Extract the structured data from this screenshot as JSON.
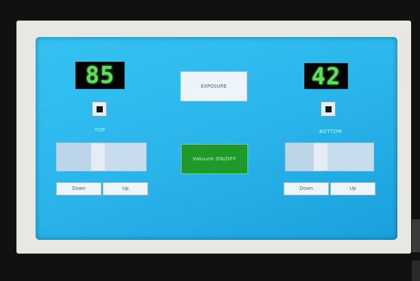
{
  "top": {
    "display_value": "85",
    "label": "TOP",
    "slider_value_fraction": 0.45,
    "down_label": "Down",
    "up_label": "Up"
  },
  "bottom": {
    "display_value": "42",
    "label": "BOTTOM",
    "slider_value_fraction": 0.38,
    "down_label": "Down",
    "up_label": "Up"
  },
  "center": {
    "exposure_label": "EXPOSURE",
    "vacuum_label": "Vakuum ON/OFF"
  },
  "colors": {
    "screen": "#2bb7ec",
    "segment_digits": "#5fe05a",
    "vacuum_button": "#1e9a2a"
  }
}
